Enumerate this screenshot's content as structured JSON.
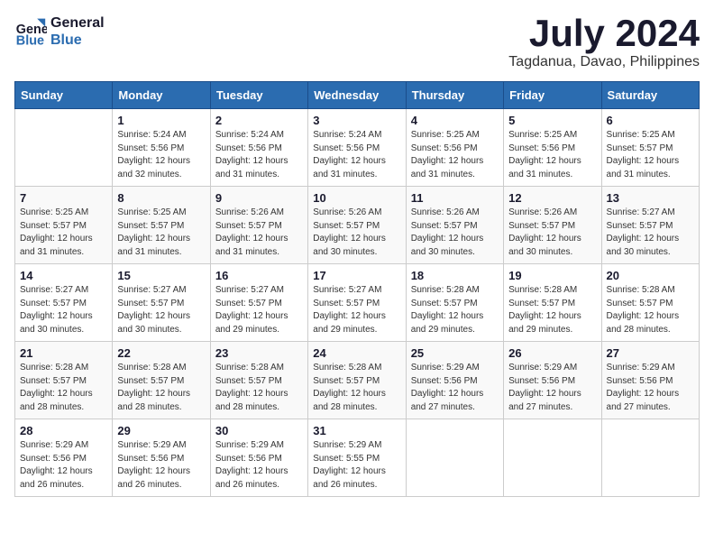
{
  "header": {
    "logo_line1": "General",
    "logo_line2": "Blue",
    "month_title": "July 2024",
    "subtitle": "Tagdanua, Davao, Philippines"
  },
  "weekdays": [
    "Sunday",
    "Monday",
    "Tuesday",
    "Wednesday",
    "Thursday",
    "Friday",
    "Saturday"
  ],
  "weeks": [
    [
      {
        "day": "",
        "info": ""
      },
      {
        "day": "1",
        "info": "Sunrise: 5:24 AM\nSunset: 5:56 PM\nDaylight: 12 hours\nand 32 minutes."
      },
      {
        "day": "2",
        "info": "Sunrise: 5:24 AM\nSunset: 5:56 PM\nDaylight: 12 hours\nand 31 minutes."
      },
      {
        "day": "3",
        "info": "Sunrise: 5:24 AM\nSunset: 5:56 PM\nDaylight: 12 hours\nand 31 minutes."
      },
      {
        "day": "4",
        "info": "Sunrise: 5:25 AM\nSunset: 5:56 PM\nDaylight: 12 hours\nand 31 minutes."
      },
      {
        "day": "5",
        "info": "Sunrise: 5:25 AM\nSunset: 5:56 PM\nDaylight: 12 hours\nand 31 minutes."
      },
      {
        "day": "6",
        "info": "Sunrise: 5:25 AM\nSunset: 5:57 PM\nDaylight: 12 hours\nand 31 minutes."
      }
    ],
    [
      {
        "day": "7",
        "info": "Sunrise: 5:25 AM\nSunset: 5:57 PM\nDaylight: 12 hours\nand 31 minutes."
      },
      {
        "day": "8",
        "info": "Sunrise: 5:25 AM\nSunset: 5:57 PM\nDaylight: 12 hours\nand 31 minutes."
      },
      {
        "day": "9",
        "info": "Sunrise: 5:26 AM\nSunset: 5:57 PM\nDaylight: 12 hours\nand 31 minutes."
      },
      {
        "day": "10",
        "info": "Sunrise: 5:26 AM\nSunset: 5:57 PM\nDaylight: 12 hours\nand 30 minutes."
      },
      {
        "day": "11",
        "info": "Sunrise: 5:26 AM\nSunset: 5:57 PM\nDaylight: 12 hours\nand 30 minutes."
      },
      {
        "day": "12",
        "info": "Sunrise: 5:26 AM\nSunset: 5:57 PM\nDaylight: 12 hours\nand 30 minutes."
      },
      {
        "day": "13",
        "info": "Sunrise: 5:27 AM\nSunset: 5:57 PM\nDaylight: 12 hours\nand 30 minutes."
      }
    ],
    [
      {
        "day": "14",
        "info": "Sunrise: 5:27 AM\nSunset: 5:57 PM\nDaylight: 12 hours\nand 30 minutes."
      },
      {
        "day": "15",
        "info": "Sunrise: 5:27 AM\nSunset: 5:57 PM\nDaylight: 12 hours\nand 30 minutes."
      },
      {
        "day": "16",
        "info": "Sunrise: 5:27 AM\nSunset: 5:57 PM\nDaylight: 12 hours\nand 29 minutes."
      },
      {
        "day": "17",
        "info": "Sunrise: 5:27 AM\nSunset: 5:57 PM\nDaylight: 12 hours\nand 29 minutes."
      },
      {
        "day": "18",
        "info": "Sunrise: 5:28 AM\nSunset: 5:57 PM\nDaylight: 12 hours\nand 29 minutes."
      },
      {
        "day": "19",
        "info": "Sunrise: 5:28 AM\nSunset: 5:57 PM\nDaylight: 12 hours\nand 29 minutes."
      },
      {
        "day": "20",
        "info": "Sunrise: 5:28 AM\nSunset: 5:57 PM\nDaylight: 12 hours\nand 28 minutes."
      }
    ],
    [
      {
        "day": "21",
        "info": "Sunrise: 5:28 AM\nSunset: 5:57 PM\nDaylight: 12 hours\nand 28 minutes."
      },
      {
        "day": "22",
        "info": "Sunrise: 5:28 AM\nSunset: 5:57 PM\nDaylight: 12 hours\nand 28 minutes."
      },
      {
        "day": "23",
        "info": "Sunrise: 5:28 AM\nSunset: 5:57 PM\nDaylight: 12 hours\nand 28 minutes."
      },
      {
        "day": "24",
        "info": "Sunrise: 5:28 AM\nSunset: 5:57 PM\nDaylight: 12 hours\nand 28 minutes."
      },
      {
        "day": "25",
        "info": "Sunrise: 5:29 AM\nSunset: 5:56 PM\nDaylight: 12 hours\nand 27 minutes."
      },
      {
        "day": "26",
        "info": "Sunrise: 5:29 AM\nSunset: 5:56 PM\nDaylight: 12 hours\nand 27 minutes."
      },
      {
        "day": "27",
        "info": "Sunrise: 5:29 AM\nSunset: 5:56 PM\nDaylight: 12 hours\nand 27 minutes."
      }
    ],
    [
      {
        "day": "28",
        "info": "Sunrise: 5:29 AM\nSunset: 5:56 PM\nDaylight: 12 hours\nand 26 minutes."
      },
      {
        "day": "29",
        "info": "Sunrise: 5:29 AM\nSunset: 5:56 PM\nDaylight: 12 hours\nand 26 minutes."
      },
      {
        "day": "30",
        "info": "Sunrise: 5:29 AM\nSunset: 5:56 PM\nDaylight: 12 hours\nand 26 minutes."
      },
      {
        "day": "31",
        "info": "Sunrise: 5:29 AM\nSunset: 5:55 PM\nDaylight: 12 hours\nand 26 minutes."
      },
      {
        "day": "",
        "info": ""
      },
      {
        "day": "",
        "info": ""
      },
      {
        "day": "",
        "info": ""
      }
    ]
  ]
}
